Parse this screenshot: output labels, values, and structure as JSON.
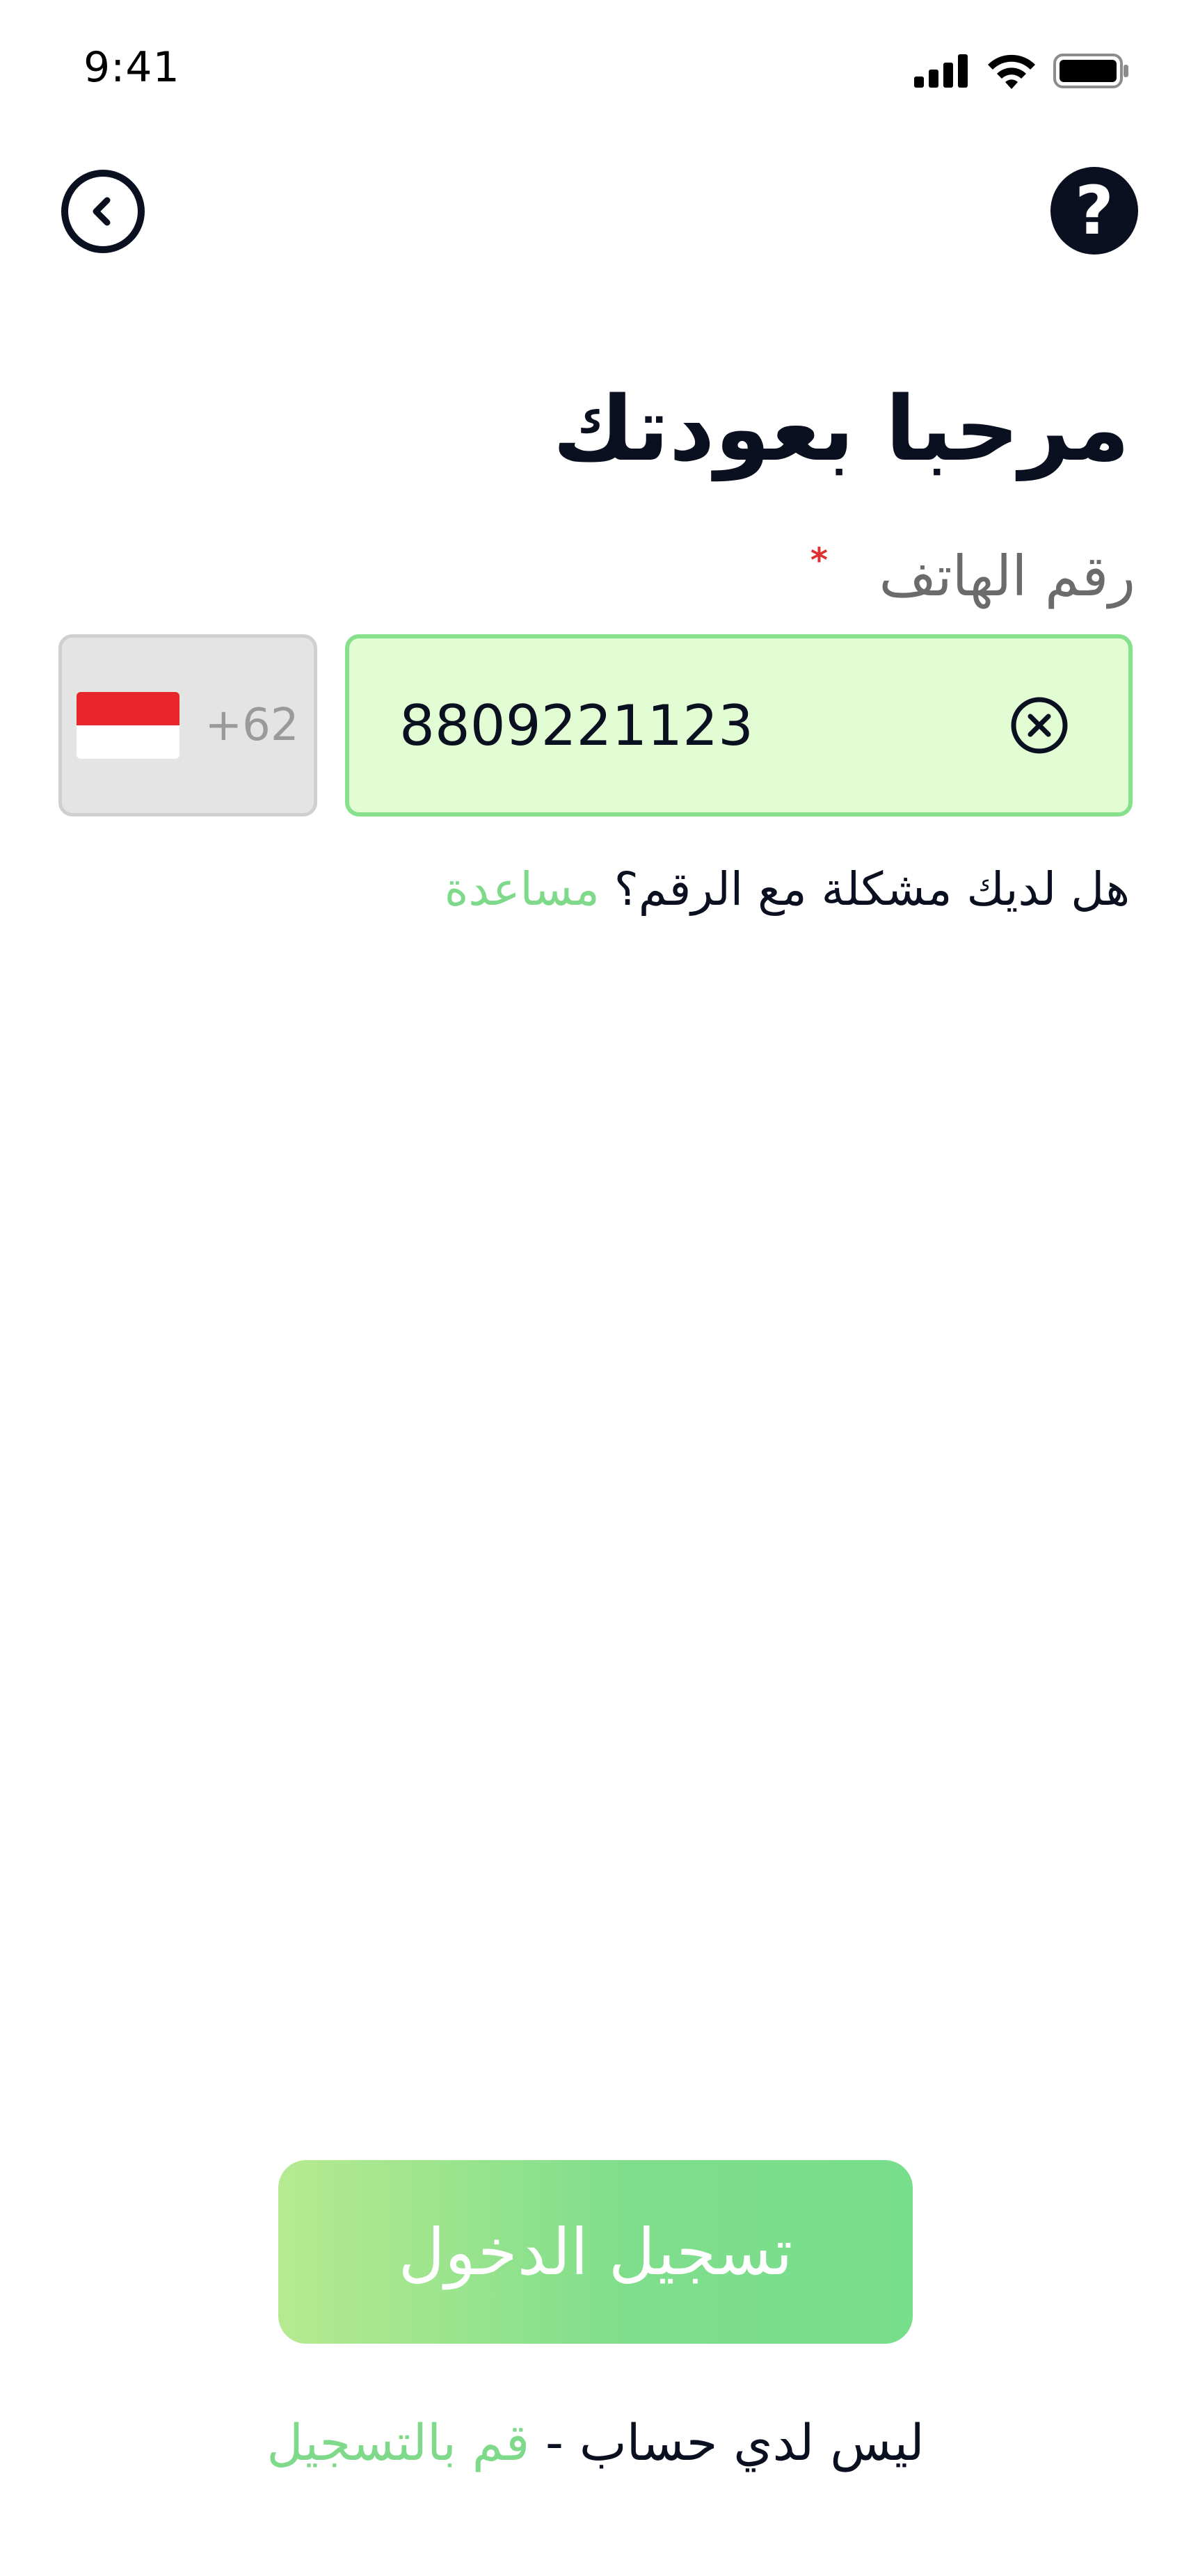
{
  "status_bar": {
    "time": "9:41",
    "icons": [
      "cellular-signal-icon",
      "wifi-icon",
      "battery-icon"
    ]
  },
  "nav": {
    "back_icon": "chevron-left-circle-icon",
    "help_icon": "question-mark-icon",
    "help_glyph": "?"
  },
  "header": {
    "title": "مرحبا بعودتك"
  },
  "phone_field": {
    "label": "رقم الهاتف",
    "required_marker": "*",
    "country_code": "+62",
    "country_flag": "indonesia-flag-icon",
    "value": "8809221123",
    "clear_icon": "clear-circle-x-icon"
  },
  "help_line": {
    "text": "هل لديك مشكلة مع الرقم؟",
    "link": "مساعدة"
  },
  "actions": {
    "login_label": "تسجيل الدخول"
  },
  "register_line": {
    "text": "ليس لدي حساب -",
    "link": "قم بالتسجيل"
  },
  "colors": {
    "primary_text": "#0b1020",
    "accent_green": "#7ed98a",
    "input_bg": "#e2fdd4",
    "input_border": "#86e08c",
    "required_red": "#e0302f"
  }
}
